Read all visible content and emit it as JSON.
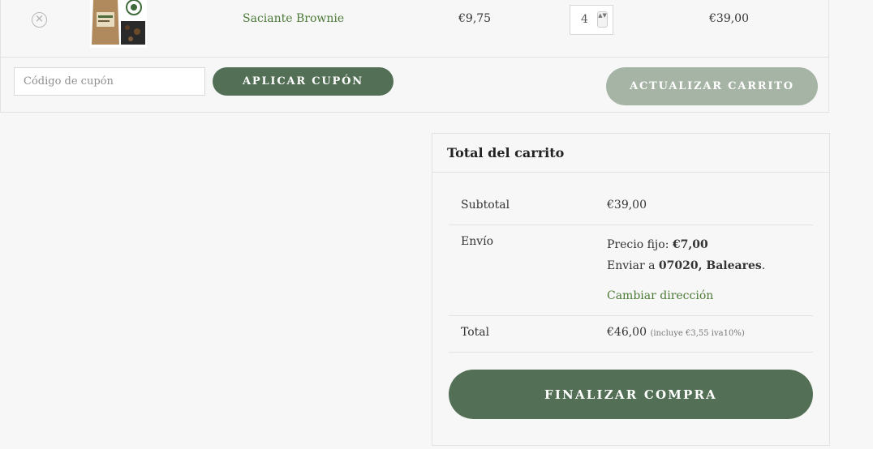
{
  "cart": {
    "item": {
      "remove_glyph": "×",
      "name": "Saciante Brownie",
      "price": "€9,75",
      "quantity": "4",
      "spin_glyph": "▲▼",
      "subtotal": "€39,00"
    },
    "coupon_placeholder": "Código de cupón",
    "apply_label": "APLICAR CUPÓN",
    "update_label": "ACTUALIZAR CARRITO"
  },
  "totals": {
    "title": "Total del carrito",
    "subtotal_label": "Subtotal",
    "subtotal_value": "€39,00",
    "shipping_label": "Envío",
    "shipping_rate_label": "Precio fijo: ",
    "shipping_rate_value": "€7,00",
    "ship_to_label": "Enviar a ",
    "ship_to_value": "07020, Baleares",
    "ship_to_period": ".",
    "change_address": "Cambiar dirección",
    "total_label": "Total",
    "total_value": "€46,00",
    "tax_note": "(incluye €3,55 iva10%)",
    "checkout_label": "FINALIZAR COMPRA"
  },
  "colors": {
    "accent_green": "#536f55",
    "link_green": "#4b7a36",
    "disabled_green": "#a6b4a6",
    "background": "#f7f7f7"
  }
}
